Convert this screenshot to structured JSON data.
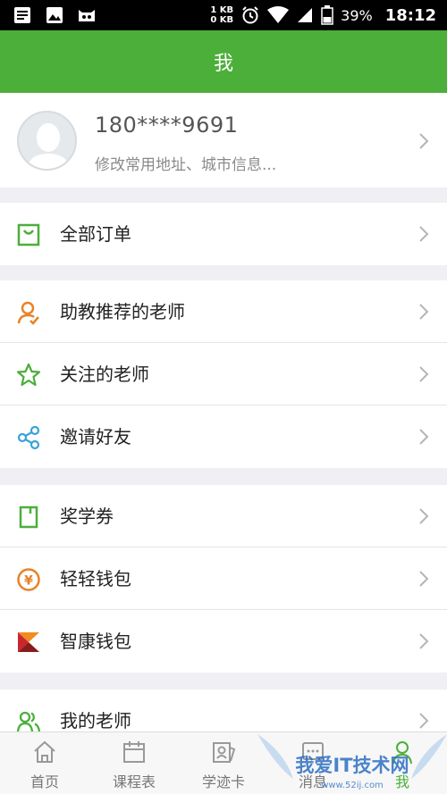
{
  "status_bar": {
    "net_up": "1 KB",
    "net_down": "0 KB",
    "battery": "39%",
    "time": "18:12"
  },
  "header": {
    "title": "我"
  },
  "profile": {
    "phone": "180****9691",
    "subtitle": "修改常用地址、城市信息..."
  },
  "menu": {
    "orders": "全部订单",
    "recommended_teachers": "助教推荐的老师",
    "followed_teachers": "关注的老师",
    "invite_friends": "邀请好友",
    "scholarship": "奖学券",
    "easy_wallet": "轻轻钱包",
    "zhikang_wallet": "智康钱包",
    "my_teachers": "我的老师"
  },
  "tabs": [
    {
      "label": "首页"
    },
    {
      "label": "课程表"
    },
    {
      "label": "学迹卡"
    },
    {
      "label": "消息"
    },
    {
      "label": "我"
    }
  ],
  "watermark": {
    "text": "我爱IT技术网",
    "url": "www.52ij.com"
  },
  "colors": {
    "brand_green": "#4caf3a",
    "orange": "#e8822a",
    "blue": "#3aa3d9",
    "background": "#efeff4"
  }
}
